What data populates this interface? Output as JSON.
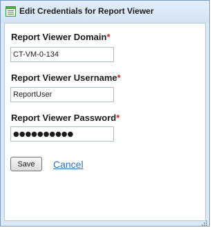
{
  "window": {
    "title": "Edit Credentials for Report Viewer",
    "icon": "form-icon"
  },
  "form": {
    "required_marker": "*",
    "domain": {
      "label": "Report Viewer Domain",
      "value": "CT-VM-0-134"
    },
    "username": {
      "label": "Report Viewer Username",
      "value": "ReportUser"
    },
    "password": {
      "label": "Report Viewer Password",
      "value": "●●●●●●●●●●"
    }
  },
  "actions": {
    "save_label": "Save",
    "cancel_label": "Cancel"
  },
  "colors": {
    "required": "#c1272d",
    "link": "#2f6fb5",
    "window_border": "#7a9bbd",
    "titlebar": "#dbe8f6"
  }
}
